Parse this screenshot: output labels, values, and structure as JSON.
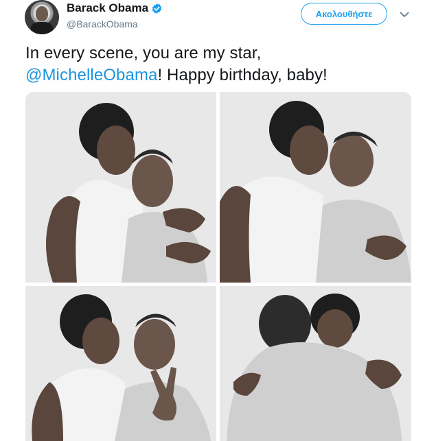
{
  "tweet": {
    "author": {
      "display_name": "Barack Obama",
      "handle": "@BarackObama",
      "verified": true,
      "verified_icon": "verified-badge-icon",
      "avatar_icon": "avatar"
    },
    "follow_label": "Ακολουθήστε",
    "more_icon": "chevron-down-icon",
    "text_before": "In every scene, you are my star,",
    "mention": "@MichelleObama",
    "text_after": "! Happy birthday, baby!",
    "media": {
      "photos": [
        {
          "description_icon": "photo-booth-hug"
        },
        {
          "description_icon": "photo-booth-kiss"
        },
        {
          "description_icon": "photo-booth-peace-sign"
        },
        {
          "description_icon": "photo-booth-embrace"
        }
      ]
    }
  },
  "colors": {
    "accent": "#1da1f2",
    "mention": "#1b95e0",
    "text": "#14171a",
    "secondary_text": "#657786",
    "photo_background": "#e6e6e6"
  }
}
